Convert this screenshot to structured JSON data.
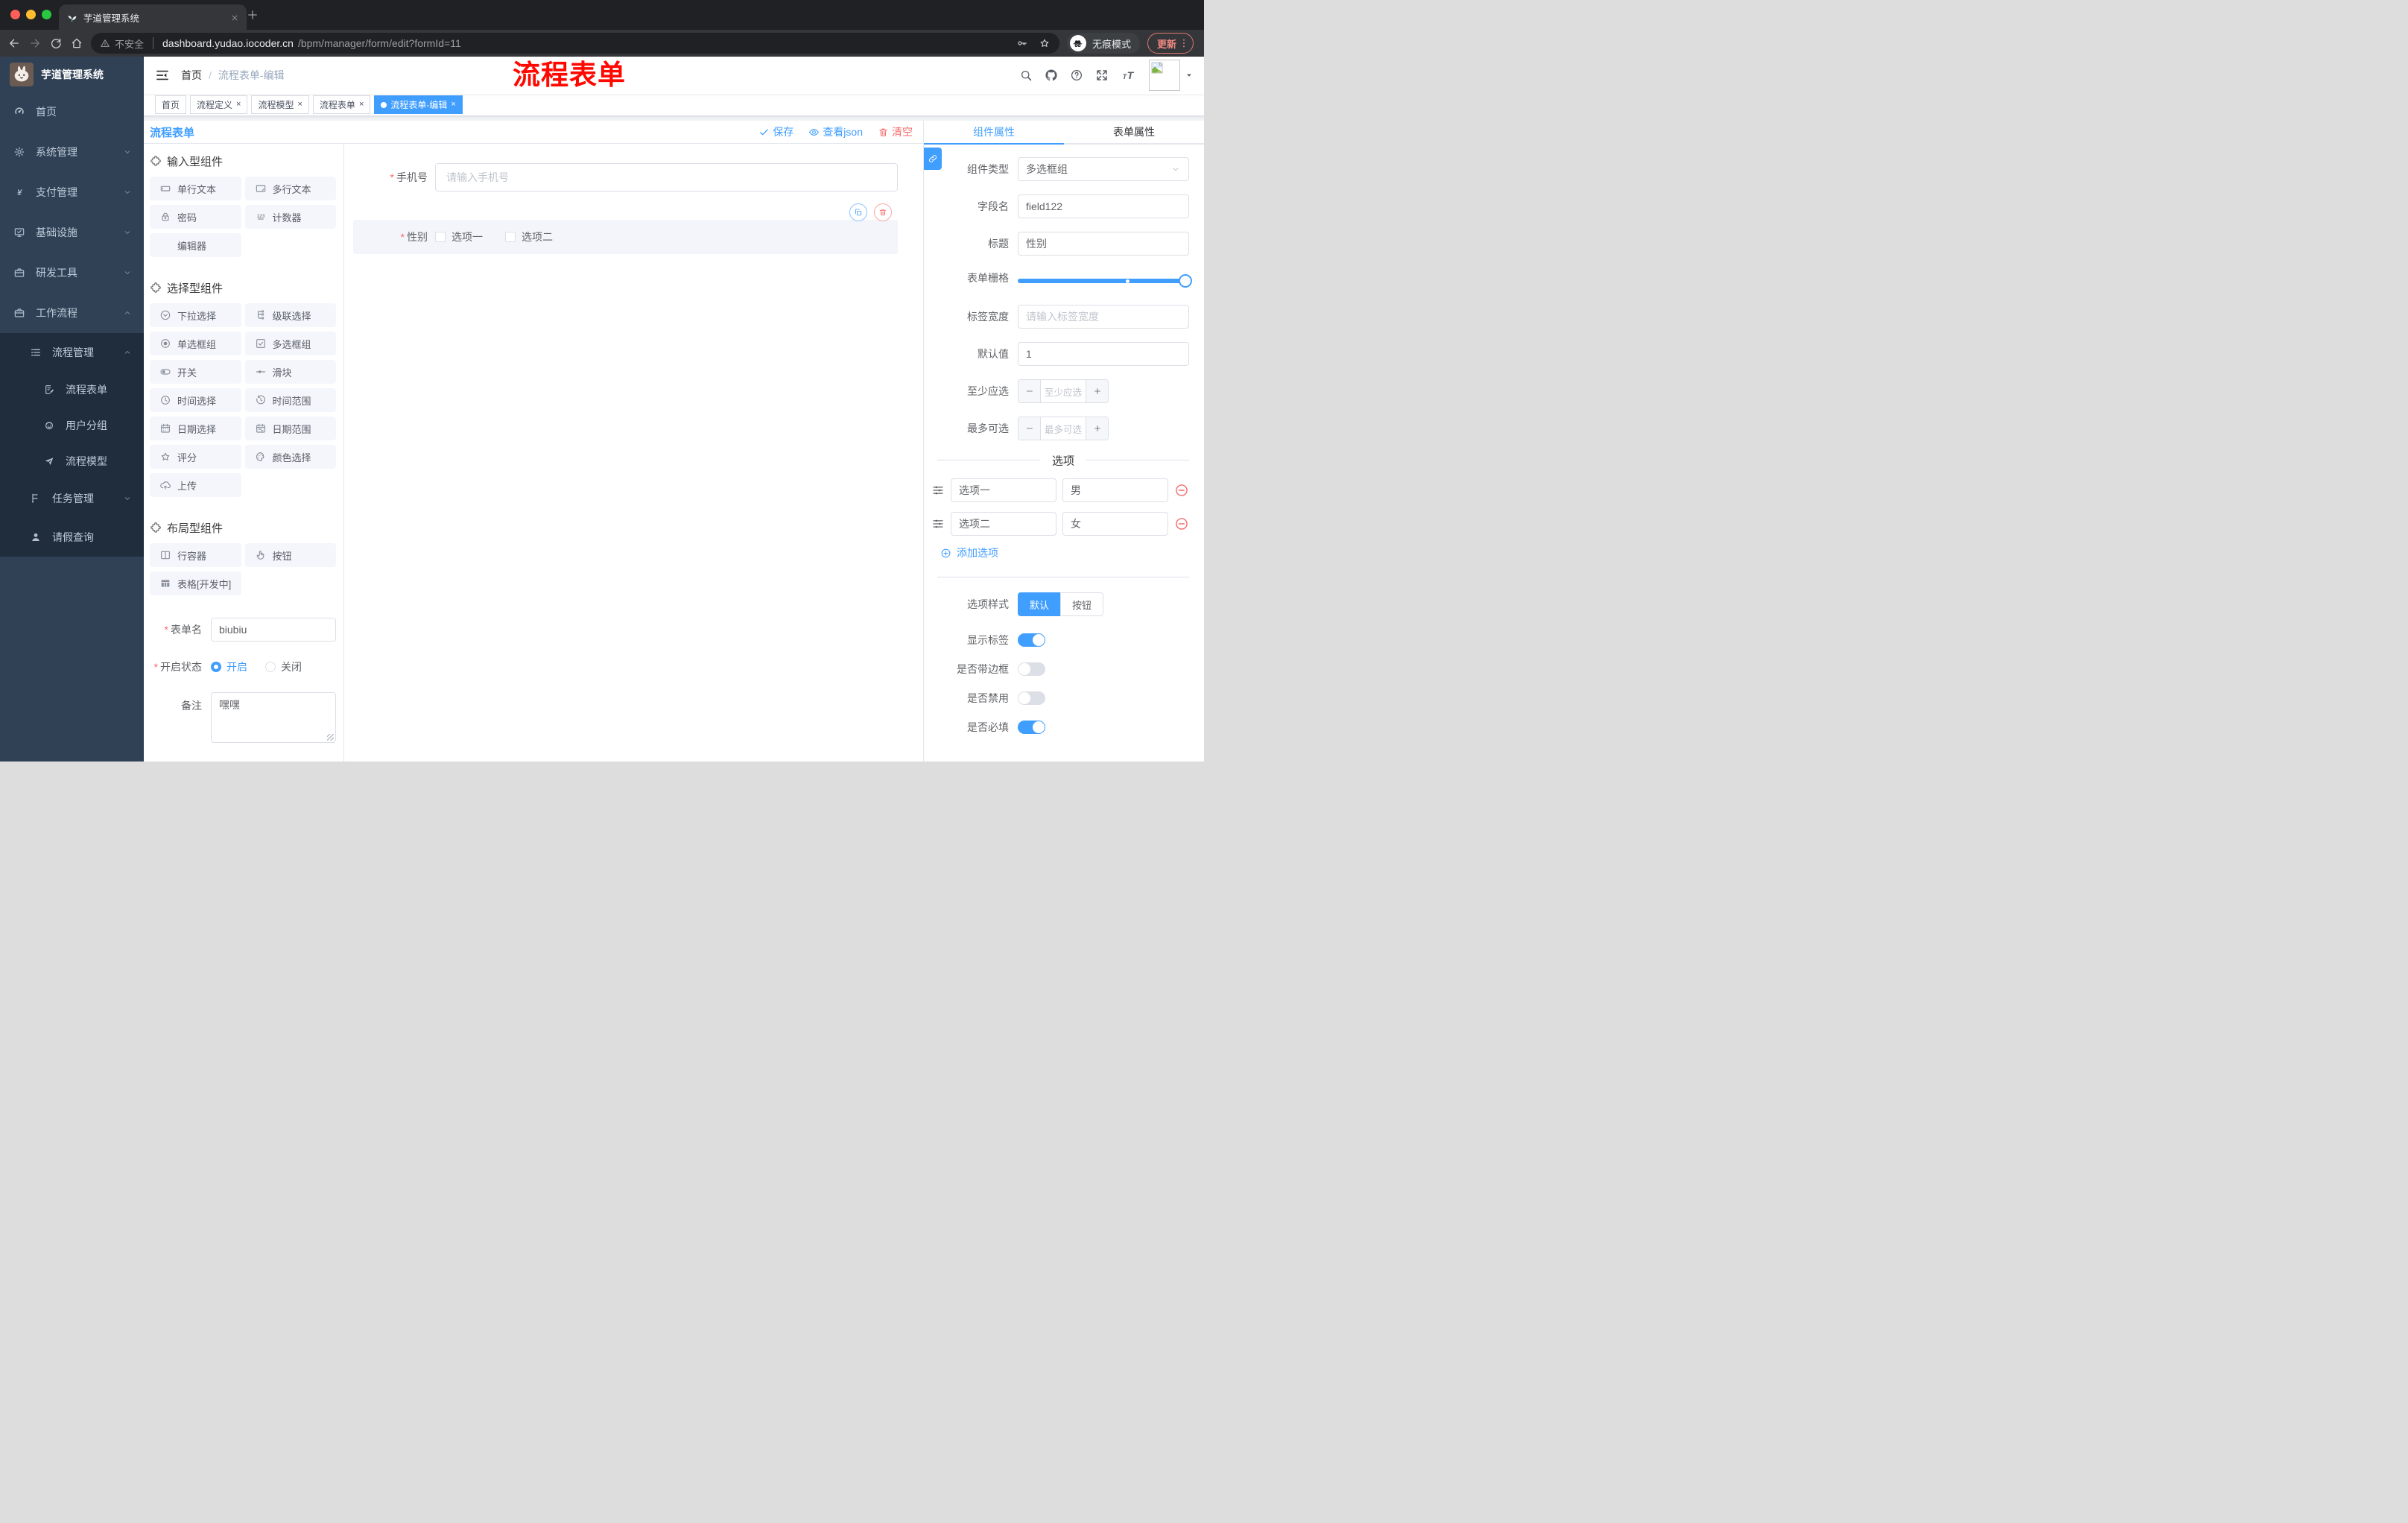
{
  "browser": {
    "tab_title": "芋道管理系统",
    "not_secure_label": "不安全",
    "url_host": "dashboard.yudao.iocoder.cn",
    "url_path": "/bpm/manager/form/edit?formId=11",
    "incognito_label": "无痕模式",
    "update_label": "更新"
  },
  "sidebar": {
    "title": "芋道管理系统",
    "items": [
      {
        "label": "首页",
        "icon": "dashboard-icon",
        "depth": 0
      },
      {
        "label": "系统管理",
        "icon": "gear-icon",
        "depth": 0,
        "chevron": "down"
      },
      {
        "label": "支付管理",
        "icon": "yen-icon",
        "depth": 0,
        "chevron": "down"
      },
      {
        "label": "基础设施",
        "icon": "monitor-icon",
        "depth": 0,
        "chevron": "down"
      },
      {
        "label": "研发工具",
        "icon": "briefcase-icon",
        "depth": 0,
        "chevron": "down"
      },
      {
        "label": "工作流程",
        "icon": "briefcase-icon",
        "depth": 0,
        "chevron": "up"
      },
      {
        "label": "流程管理",
        "icon": "list-icon",
        "depth": 1,
        "chevron": "up",
        "dark": true
      },
      {
        "label": "流程表单",
        "icon": "form-icon",
        "depth": 2,
        "dark": true
      },
      {
        "label": "用户分组",
        "icon": "users-icon",
        "depth": 2,
        "dark": true
      },
      {
        "label": "流程模型",
        "icon": "send-icon",
        "depth": 2,
        "dark": true
      },
      {
        "label": "任务管理",
        "icon": "tree-icon",
        "depth": 1,
        "chevron": "down",
        "dark": true
      },
      {
        "label": "请假查询",
        "icon": "person-icon",
        "depth": 1,
        "dark": true
      }
    ]
  },
  "navbar": {
    "breadcrumb_home": "首页",
    "breadcrumb_current": "流程表单-编辑",
    "annotation": "流程表单"
  },
  "tags": [
    {
      "label": "首页",
      "closable": false,
      "active": false
    },
    {
      "label": "流程定义",
      "closable": true,
      "active": false
    },
    {
      "label": "流程模型",
      "closable": true,
      "active": false
    },
    {
      "label": "流程表单",
      "closable": true,
      "active": false
    },
    {
      "label": "流程表单-编辑",
      "closable": true,
      "active": true
    }
  ],
  "designer": {
    "title": "流程表单",
    "save_label": "保存",
    "view_json_label": "查看json",
    "clear_label": "清空"
  },
  "palette": {
    "sections": [
      {
        "title": "输入型组件",
        "items": [
          {
            "label": "单行文本",
            "icon": "input-icon"
          },
          {
            "label": "多行文本",
            "icon": "textarea-icon"
          },
          {
            "label": "密码",
            "icon": "lock-icon"
          },
          {
            "label": "计数器",
            "icon": "counter-icon"
          },
          {
            "label": "编辑器",
            "icon": "editor-icon"
          }
        ]
      },
      {
        "title": "选择型组件",
        "items": [
          {
            "label": "下拉选择",
            "icon": "select-icon"
          },
          {
            "label": "级联选择",
            "icon": "cascader-icon"
          },
          {
            "label": "单选框组",
            "icon": "radio-icon"
          },
          {
            "label": "多选框组",
            "icon": "checkbox-icon"
          },
          {
            "label": "开关",
            "icon": "switch-icon"
          },
          {
            "label": "滑块",
            "icon": "slider-icon"
          },
          {
            "label": "时间选择",
            "icon": "time-icon"
          },
          {
            "label": "时间范围",
            "icon": "time-range-icon"
          },
          {
            "label": "日期选择",
            "icon": "date-icon"
          },
          {
            "label": "日期范围",
            "icon": "date-range-icon"
          },
          {
            "label": "评分",
            "icon": "rate-icon"
          },
          {
            "label": "颜色选择",
            "icon": "color-icon"
          },
          {
            "label": "上传",
            "icon": "upload-icon"
          }
        ]
      },
      {
        "title": "布局型组件",
        "items": [
          {
            "label": "行容器",
            "icon": "row-icon"
          },
          {
            "label": "按钮",
            "icon": "button-icon"
          },
          {
            "label": "表格[开发中]",
            "icon": "table-icon"
          }
        ]
      }
    ],
    "form": {
      "name_label": "表单名",
      "name_value": "biubiu",
      "status_label": "开启状态",
      "status_on": "开启",
      "status_off": "关闭",
      "remark_label": "备注",
      "remark_value": "嘿嘿"
    }
  },
  "canvas": {
    "phone": {
      "label": "手机号",
      "placeholder": "请输入手机号"
    },
    "gender": {
      "label": "性别",
      "options": [
        "选项一",
        "选项二"
      ]
    }
  },
  "panel": {
    "tabs": [
      "组件属性",
      "表单属性"
    ],
    "active_tab": "组件属性",
    "component_type": {
      "label": "组件类型",
      "value": "多选框组"
    },
    "field_name": {
      "label": "字段名",
      "value": "field122"
    },
    "title": {
      "label": "标题",
      "value": "性别"
    },
    "grid": {
      "label": "表单栅格"
    },
    "label_width": {
      "label": "标签宽度",
      "placeholder": "请输入标签宽度"
    },
    "default": {
      "label": "默认值",
      "value": "1"
    },
    "min": {
      "label": "至少应选",
      "placeholder": "至少应选"
    },
    "max": {
      "label": "最多可选",
      "placeholder": "最多可选"
    },
    "options_title": "选项",
    "options": [
      {
        "label": "选项一",
        "value": "男"
      },
      {
        "label": "选项二",
        "value": "女"
      }
    ],
    "add_option_label": "添加选项",
    "style": {
      "label": "选项样式",
      "options": [
        "默认",
        "按钮"
      ],
      "active": "默认"
    },
    "switches": [
      {
        "label": "显示标签",
        "on": true
      },
      {
        "label": "是否带边框",
        "on": false
      },
      {
        "label": "是否禁用",
        "on": false
      },
      {
        "label": "是否必填",
        "on": true
      }
    ]
  },
  "colors": {
    "primary": "#409eff",
    "danger": "#f56c6c",
    "sidebar_bg": "#304156",
    "submenu_bg": "#1f2d3d",
    "active_tag": "#409eff",
    "annotation": "#ff0800"
  }
}
